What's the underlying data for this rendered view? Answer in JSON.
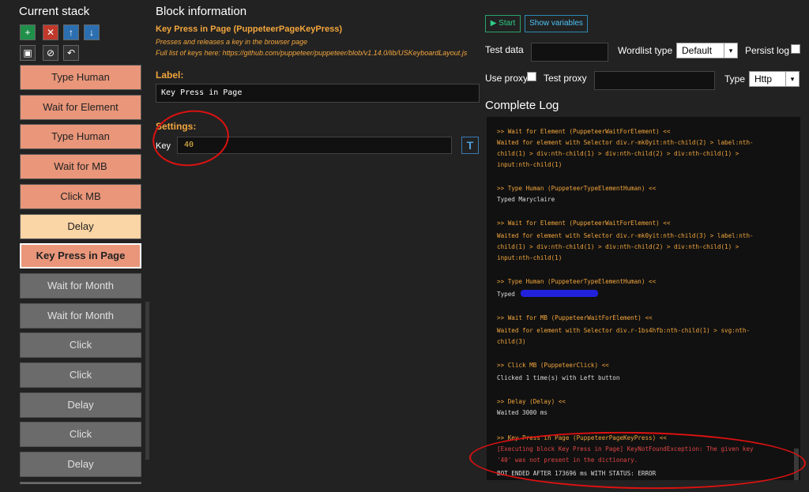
{
  "stack": {
    "title": "Current stack",
    "toolbar": [
      "plus-icon",
      "remove-icon",
      "arrow-up-icon",
      "arrow-down-icon",
      "clone-icon",
      "disable-icon",
      "undo-icon"
    ],
    "items": [
      {
        "label": "Type Human",
        "state": "active"
      },
      {
        "label": "Wait for Element",
        "state": "active"
      },
      {
        "label": "Type Human",
        "state": "active"
      },
      {
        "label": "Wait for MB",
        "state": "active"
      },
      {
        "label": "Click MB",
        "state": "active"
      },
      {
        "label": "Delay",
        "state": "light"
      },
      {
        "label": "Key Press in Page",
        "state": "selected"
      },
      {
        "label": "Wait for Month",
        "state": "disabled"
      },
      {
        "label": "Wait for Month",
        "state": "disabled"
      },
      {
        "label": "Click",
        "state": "disabled"
      },
      {
        "label": "Click",
        "state": "disabled"
      },
      {
        "label": "Delay",
        "state": "disabled"
      },
      {
        "label": "Click",
        "state": "disabled"
      },
      {
        "label": "Delay",
        "state": "disabled"
      },
      {
        "label": "",
        "state": "disabled"
      }
    ]
  },
  "block": {
    "heading": "Block information",
    "name": "Key Press in Page (PuppeteerPageKeyPress)",
    "desc1": "Presses and releases a key in the browser page",
    "desc2": "Full list of keys here: https://github.com/puppeteer/puppeteer/blob/v1.14.0/lib/USKeyboardLayout.js",
    "label_heading": "Label:",
    "label_value": "Key Press in Page",
    "settings_heading": "Settings:",
    "key_label": "Key",
    "key_value": "40",
    "type_icon": "T"
  },
  "debugger": {
    "start_label": "▶ Start",
    "show_variables_label": "Show variables",
    "test_data_label": "Test data",
    "test_data_value": "",
    "wordlist_type_label": "Wordlist type",
    "wordlist_type_value": "Default",
    "persist_log_label": "Persist log",
    "use_proxy_label": "Use proxy",
    "test_proxy_label": "Test proxy",
    "test_proxy_value": "",
    "type_label": "Type",
    "type_value": "Http",
    "complete_log_label": "Complete Log"
  },
  "log": [
    {
      "text": ">> Wait for Element (PuppeteerWaitForElement) <<",
      "color": "orange"
    },
    {
      "text": "Waited for element with Selector div.r-mk0yit:nth-child(2) > label:nth-",
      "color": "orange"
    },
    {
      "text": "child(1) > div:nth-child(1) > div:nth-child(2) > div:nth-child(1) >",
      "color": "orange"
    },
    {
      "text": "input:nth-child(1)",
      "color": "orange"
    },
    {
      "text": "",
      "color": "white"
    },
    {
      "text": ">> Type Human (PuppeteerTypeElementHuman) <<",
      "color": "orange"
    },
    {
      "text": "Typed Maryclaire",
      "color": "white"
    },
    {
      "text": "",
      "color": "white"
    },
    {
      "text": ">> Wait for Element (PuppeteerWaitForElement) <<",
      "color": "orange"
    },
    {
      "text": "Waited for element with Selector div.r-mk0yit:nth-child(3) > label:nth-",
      "color": "orange"
    },
    {
      "text": "child(1) > div:nth-child(1) > div:nth-child(2) > div:nth-child(1) >",
      "color": "orange"
    },
    {
      "text": "input:nth-child(1)",
      "color": "orange"
    },
    {
      "text": "",
      "color": "white"
    },
    {
      "text": ">> Type Human (PuppeteerTypeElementHuman) <<",
      "color": "orange"
    },
    {
      "text": "Typed ",
      "color": "white"
    },
    {
      "text": "",
      "color": "white"
    },
    {
      "text": ">> Wait for MB (PuppeteerWaitForElement) <<",
      "color": "orange"
    },
    {
      "text": "Waited for element with Selector div.r-1bs4hfb:nth-child(1) > svg:nth-",
      "color": "orange"
    },
    {
      "text": "child(3)",
      "color": "orange"
    },
    {
      "text": "",
      "color": "white"
    },
    {
      "text": ">> Click MB (PuppeteerClick) <<",
      "color": "orange"
    },
    {
      "text": "Clicked 1 time(s) with Left button",
      "color": "white"
    },
    {
      "text": "",
      "color": "white"
    },
    {
      "text": ">> Delay (Delay) <<",
      "color": "orange"
    },
    {
      "text": "Waited 3000 ms",
      "color": "white"
    },
    {
      "text": "",
      "color": "white"
    },
    {
      "text": ">> Key Press in Page (PuppeteerPageKeyPress) <<",
      "color": "orange"
    },
    {
      "text": "[Executing block Key Press in Page] KeyNotFoundException: The given key",
      "color": "red"
    },
    {
      "text": "'40' was not present in the dictionary.",
      "color": "red"
    },
    {
      "text": "BOT ENDED AFTER 173696 ms WITH STATUS: ERROR",
      "color": "white"
    }
  ]
}
